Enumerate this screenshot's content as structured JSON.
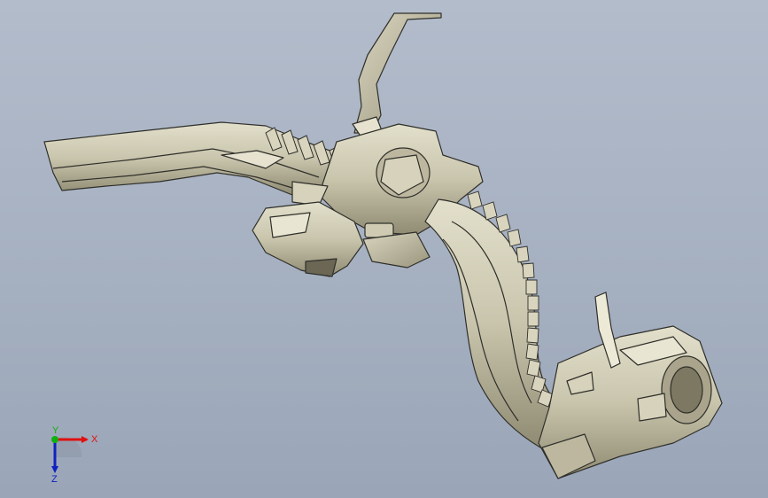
{
  "viewport": {
    "background_top": "#b3bccb",
    "background_bottom": "#9aa6b8",
    "model_fill": "#c9c5ad",
    "model_shadow": "#8f8a72",
    "edge_color": "#2f2f2a"
  },
  "triad": {
    "x_label": "X",
    "y_label": "Y",
    "z_label": "Z",
    "x_color": "#e01010",
    "y_color": "#10b010",
    "z_color": "#1020c0"
  }
}
